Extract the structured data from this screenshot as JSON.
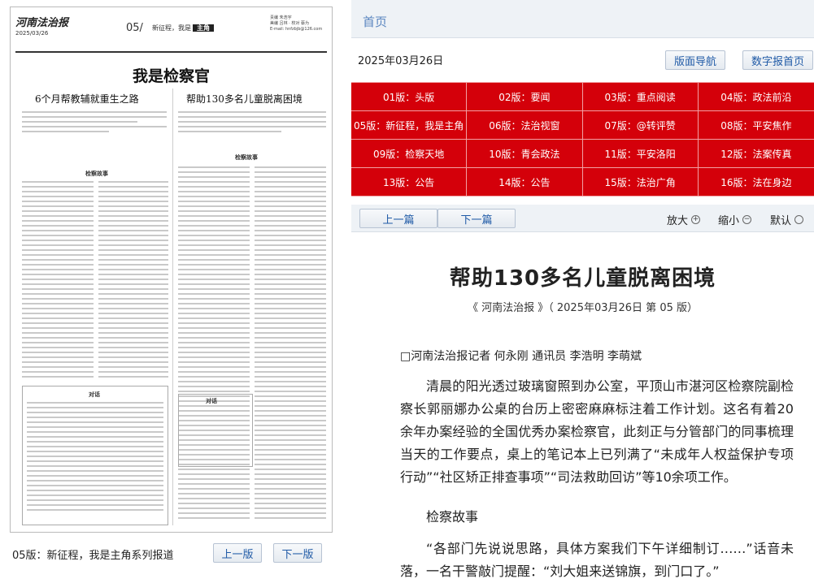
{
  "paper": {
    "logo": "河南法治报",
    "date": "2025/03/26",
    "page_no": "05/",
    "page_tag_prefix": "新征程，我是",
    "page_tag_box": "主角",
    "edit_info": "责编 朱浩宇\n美编 吕林 · 校对 蔡为\nE-mail: hnfzbjb@126.com",
    "banner": "我是检察官",
    "left_title": "6个月帮教辅就重生之路",
    "right_title": "帮助130多名儿童脱离困境",
    "left_section": "检察故事",
    "right_section": "检察故事",
    "dialog_a": "对话",
    "dialog_b": "对话"
  },
  "left_footer": {
    "label": "05版：新征程，我是主角系列报道",
    "prev": "上一版",
    "next": "下一版"
  },
  "header": {
    "home": "首页",
    "date": "2025年03月26日",
    "layout_nav": "版面导航",
    "digital_home": "数字报首页"
  },
  "pages": [
    "01版：头版",
    "02版：要闻",
    "03版：重点阅读",
    "04版：政法前沿",
    "05版：新征程，我是主角",
    "06版：法治视窗",
    "07版：@转评赞",
    "08版：平安焦作",
    "09版：检察天地",
    "10版：青会政法",
    "11版：平安洛阳",
    "12版：法案传真",
    "13版：公告",
    "14版：公告",
    "15版：法治广角",
    "16版：法在身边"
  ],
  "toolbar": {
    "prev": "上一篇",
    "next": "下一篇",
    "zoom_in": "放大",
    "zoom_out": "缩小",
    "default": "默认"
  },
  "article": {
    "title": "帮助130多名儿童脱离困境",
    "source": "《 河南法治报 》（ 2025年03月26日 第 05 版）",
    "byline": "□河南法治报记者 何永刚 通讯员 李浩明 李萌斌",
    "p1": "清晨的阳光透过玻璃窗照到办公室，平顶山市湛河区检察院副检察长郭丽娜办公桌的台历上密密麻麻标注着工作计划。这名有着20余年办案经验的全国优秀办案检察官，此刻正与分管部门的同事梳理当天的工作要点，桌上的笔记本上已列满了“未成年人权益保护专项行动”“社区矫正排查事项”“司法救助回访”等10余项工作。",
    "p2": "检察故事",
    "p3": "“各部门先说说思路，具体方案我们下午详细制订……”话音未落，一名干警敲门提醒：“刘大姐来送锦旗，到门口了。”"
  }
}
